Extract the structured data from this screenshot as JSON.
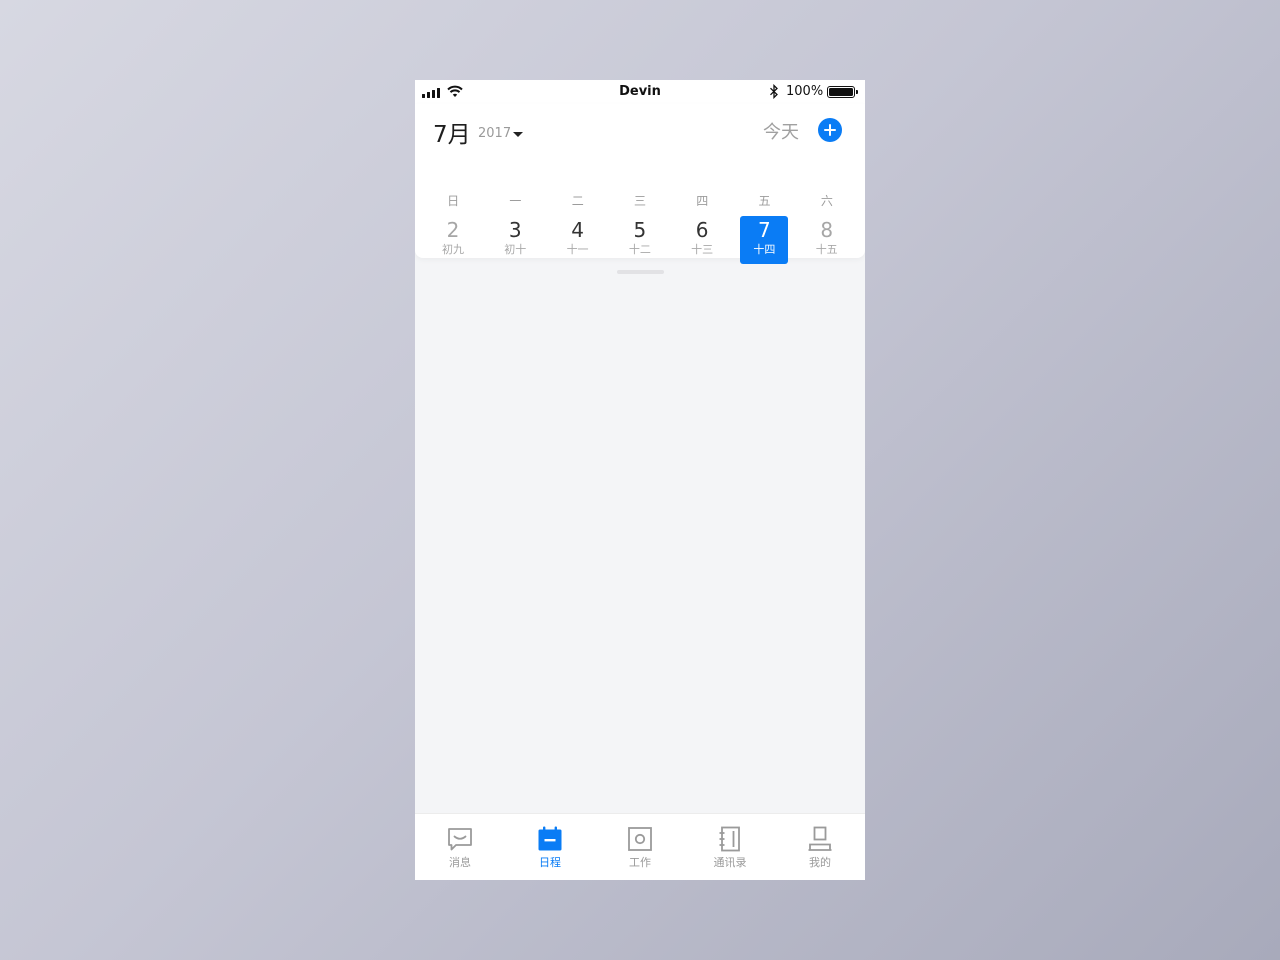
{
  "status_bar": {
    "carrier": "Devin",
    "battery_percent": "100%",
    "battery_level": 1.0
  },
  "header": {
    "month": "7月",
    "year": "2017",
    "today_label": "今天",
    "add_icon": "plus-circle-icon"
  },
  "calendar": {
    "weekdays": [
      "日",
      "一",
      "二",
      "三",
      "四",
      "五",
      "六"
    ],
    "dates": [
      {
        "day": "2",
        "lunar": "初九"
      },
      {
        "day": "3",
        "lunar": "初十"
      },
      {
        "day": "4",
        "lunar": "十一"
      },
      {
        "day": "5",
        "lunar": "十二"
      },
      {
        "day": "6",
        "lunar": "十三"
      },
      {
        "day": "7",
        "lunar": "十四"
      },
      {
        "day": "8",
        "lunar": "十五"
      }
    ],
    "selected_day": "7"
  },
  "tab_bar": {
    "items": [
      {
        "label": "消息",
        "icon": "message-icon"
      },
      {
        "label": "日程",
        "icon": "calendar-icon"
      },
      {
        "label": "工作",
        "icon": "work-icon"
      },
      {
        "label": "通讯录",
        "icon": "contacts-book-icon"
      },
      {
        "label": "我的",
        "icon": "profile-icon"
      }
    ],
    "active": "日程"
  },
  "colors": {
    "accent": "#0a7cf5",
    "muted_text": "#9a9a9a",
    "background": "#f4f5f7"
  }
}
